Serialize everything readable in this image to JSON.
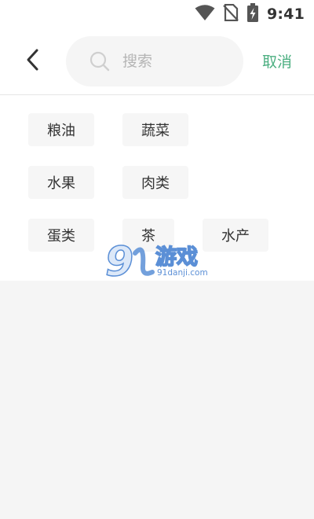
{
  "status_bar": {
    "time": "9:41",
    "icons": [
      "wifi-icon",
      "no-sim-icon",
      "battery-charging-icon"
    ]
  },
  "header": {
    "back_icon": "chevron-left-icon",
    "search": {
      "placeholder": "搜索",
      "value": "",
      "icon": "search-icon"
    },
    "cancel_label": "取消"
  },
  "categories": [
    "粮油",
    "蔬菜",
    "水果",
    "肉类",
    "蛋类",
    "茶",
    "水产"
  ],
  "watermark": {
    "mark": "9",
    "brand": "游戏",
    "site": "91danji.com"
  },
  "colors": {
    "accent": "#4caf81",
    "tag_background": "#f6f6f6",
    "page_background": "#f5f5f5"
  }
}
